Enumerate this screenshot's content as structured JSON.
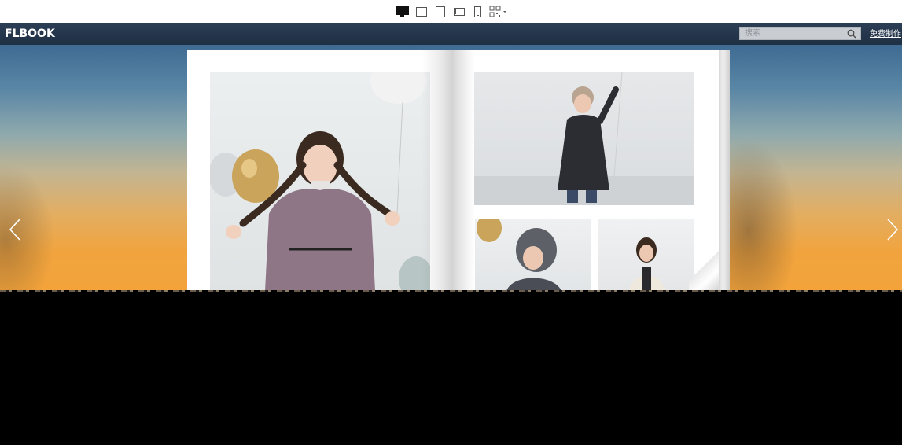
{
  "device_bar": {
    "buttons": [
      {
        "name": "desktop-view-icon",
        "active": true
      },
      {
        "name": "tablet-landscape-view-icon",
        "active": false
      },
      {
        "name": "tablet-portrait-view-icon",
        "active": false
      },
      {
        "name": "phone-landscape-view-icon",
        "active": false
      },
      {
        "name": "phone-portrait-view-icon",
        "active": false
      },
      {
        "name": "qr-code-icon",
        "active": false
      }
    ]
  },
  "header": {
    "logo": "FLBOOK",
    "search": {
      "placeholder": "搜索",
      "value": ""
    },
    "free_make_label": "免费制作"
  },
  "book": {
    "icon_names": {
      "prev": "chevron-left-icon",
      "next": "chevron-right-icon"
    }
  },
  "colors": {
    "header_bg": "#26374d",
    "search_bg": "#c9cdd2",
    "sky_top": "#3f6b93",
    "sky_bottom": "#f3a33a",
    "page_bg": "#ffffff"
  }
}
